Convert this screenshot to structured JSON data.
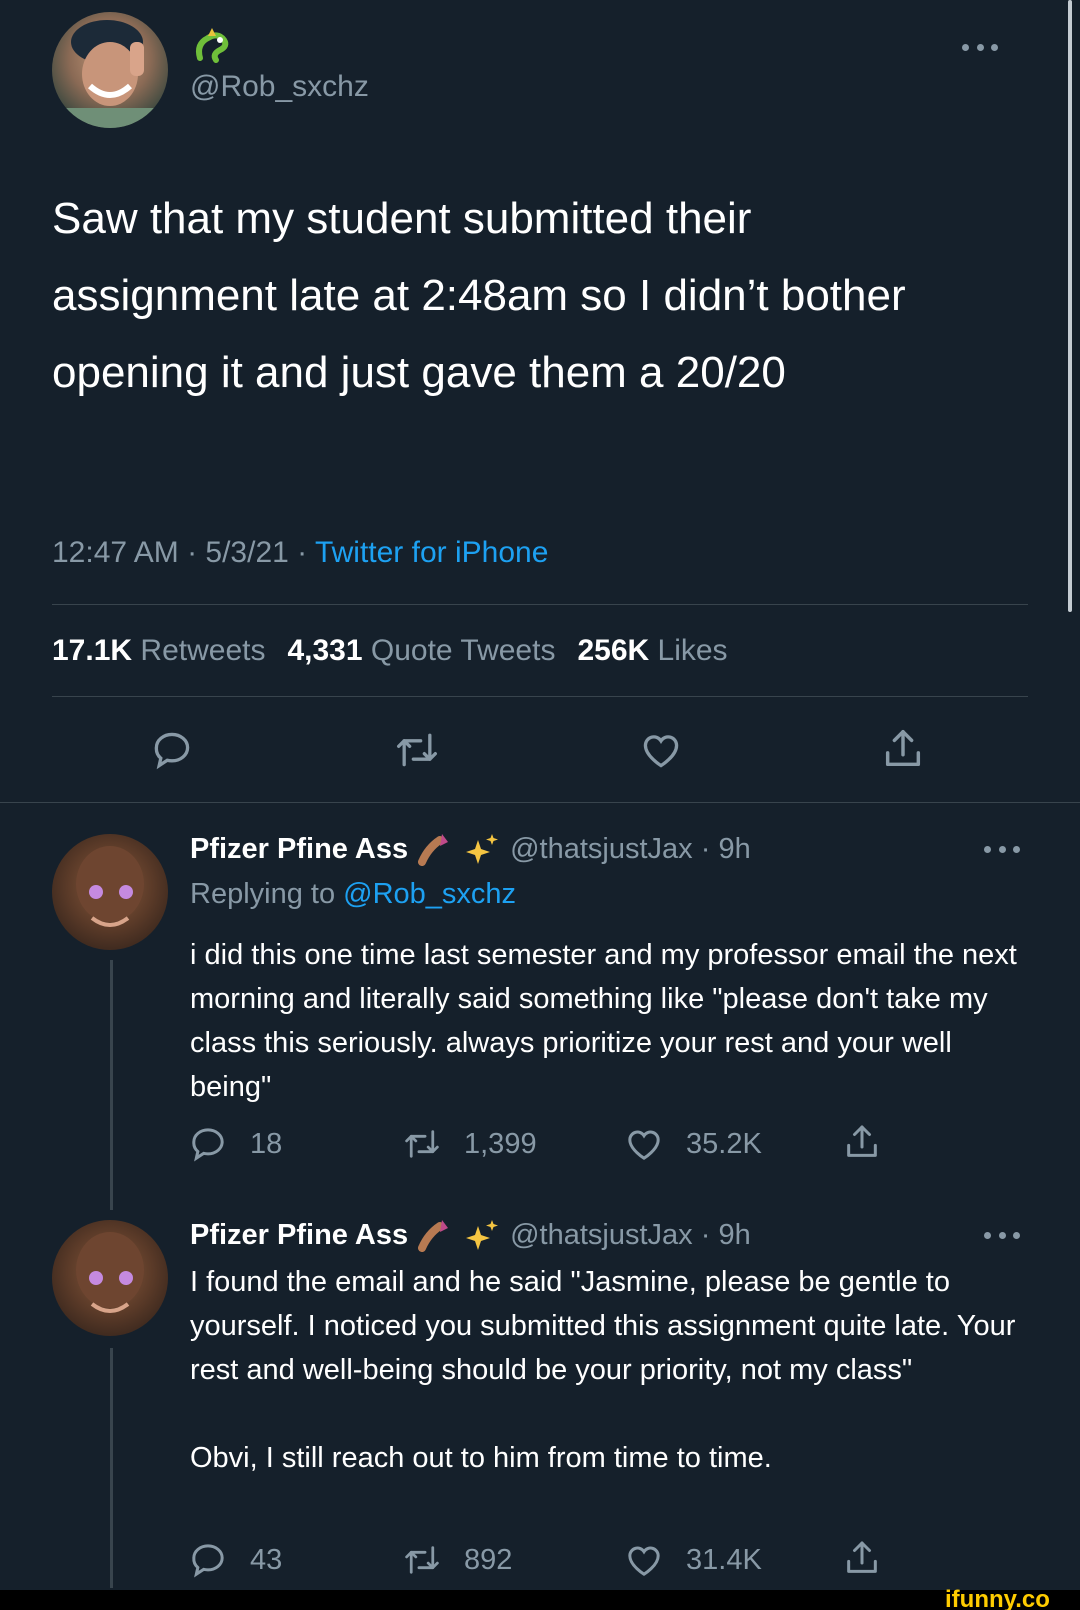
{
  "main_tweet": {
    "handle": "@Rob_sxchz",
    "text": "Saw that my student submitted their assignment late at 2:48am so I didn’t bother opening it and just gave them a 20/20",
    "time": "12:47 AM · 5/3/21 · ",
    "source": "Twitter for iPhone",
    "stats": {
      "retweets_count": "17.1K",
      "retweets_label": "Retweets",
      "quotes_count": "4,331",
      "quotes_label": "Quote Tweets",
      "likes_count": "256K",
      "likes_label": "Likes"
    }
  },
  "replies": [
    {
      "name": "Pfizer Pfine Ass",
      "handle_time": "@thatsjustJax · 9h",
      "replying_label": "Replying to ",
      "replying_to": "@Rob_sxchz",
      "text": "i did this one time last semester and my professor email the next morning and literally said something like \"please don't take my class this seriously. always prioritize your rest and your well being\"",
      "replies_count": "18",
      "retweets_count": "1,399",
      "likes_count": "35.2K"
    },
    {
      "name": "Pfizer Pfine Ass",
      "handle_time": "@thatsjustJax · 9h",
      "text": "I found the email and he said \"Jasmine, please be gentle to yourself. I noticed you submitted this assignment quite late. Your rest and well-being should be your priority, not my class\"\n\nObvi, I still reach out to him from time to time.",
      "replies_count": "43",
      "retweets_count": "892",
      "likes_count": "31.4K"
    }
  ],
  "watermark": "ifunny.co",
  "colors": {
    "background": "#15202b",
    "muted": "#8899a6",
    "link": "#1da1f2",
    "divider": "#38444d"
  }
}
